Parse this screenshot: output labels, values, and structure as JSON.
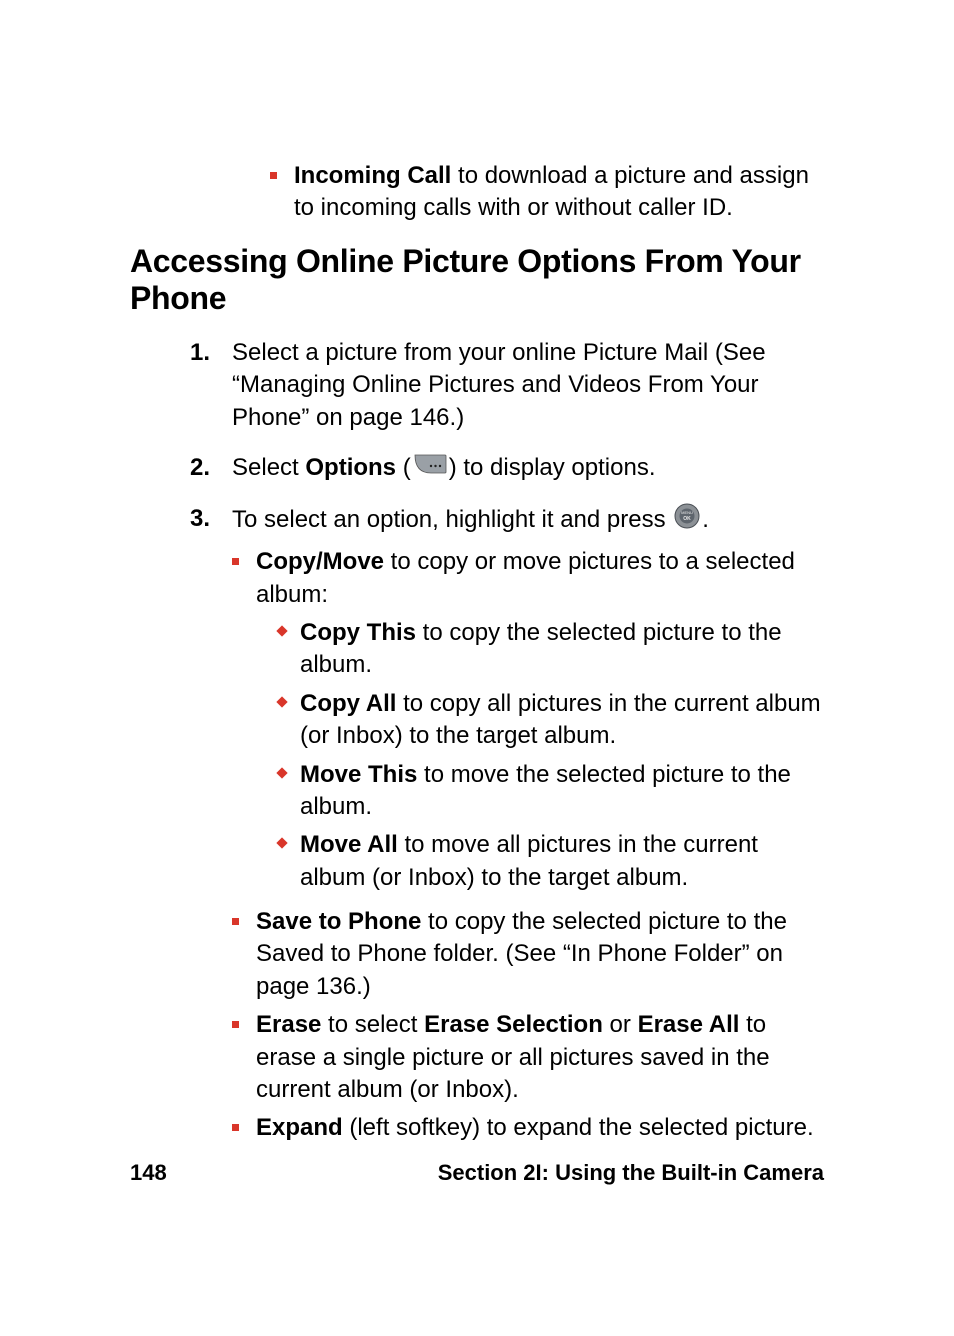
{
  "intro_bullet": {
    "bold": "Incoming Call",
    "rest": " to download a picture and assign to incoming calls with or without caller ID."
  },
  "heading": "Accessing Online Picture Options From Your Phone",
  "steps": {
    "1": {
      "num": "1.",
      "text": "Select a picture from your online Picture Mail (See “Managing Online Pictures and Videos From Your Phone” on page 146.)"
    },
    "2": {
      "num": "2.",
      "pre": "Select ",
      "bold": "Options",
      "open_paren": " (",
      "close_paren": ") to display options."
    },
    "3": {
      "num": "3.",
      "pre": "To select an option, highlight it and press ",
      "post": "."
    }
  },
  "opts": {
    "copymove": {
      "bold": "Copy/Move",
      "rest": " to copy or move pictures to a selected album:"
    },
    "copythis": {
      "bold": "Copy This",
      "rest": " to copy the selected picture to the album."
    },
    "copyall": {
      "bold": "Copy All",
      "rest": " to copy all pictures in the current album (or Inbox) to the target album."
    },
    "movethis": {
      "bold": "Move This",
      "rest": " to move the selected picture to the album."
    },
    "moveall": {
      "bold": "Move All",
      "rest": " to move all pictures in the current album (or Inbox) to the target album."
    },
    "save": {
      "bold": "Save to Phone",
      "rest": " to copy the selected picture to the Saved to Phone folder. (See “In Phone Folder” on page 136.)"
    },
    "erase": {
      "b1": "Erase",
      "t1": " to select ",
      "b2": "Erase Selection",
      "t2": " or ",
      "b3": "Erase All",
      "t3": " to erase a single picture or all pictures saved in the current album (or Inbox)."
    },
    "expand": {
      "bold": "Expand",
      "rest": " (left softkey) to expand the selected picture."
    }
  },
  "footer": {
    "page": "148",
    "section": "Section 2I: Using the Built-in Camera"
  }
}
